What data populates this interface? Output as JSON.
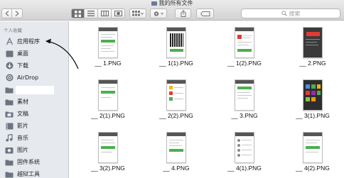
{
  "window": {
    "title": "我的所有文件"
  },
  "toolbar": {
    "search_placeholder": "搜索"
  },
  "sidebar": {
    "section_header": "个人收藏",
    "items": [
      {
        "label": "应用程序",
        "icon": "applications-icon"
      },
      {
        "label": "桌面",
        "icon": "desktop-icon"
      },
      {
        "label": "下载",
        "icon": "downloads-icon"
      },
      {
        "label": "AirDrop",
        "icon": "airdrop-icon"
      },
      {
        "label": "",
        "icon": "folder-icon"
      },
      {
        "label": "素材",
        "icon": "folder-icon"
      },
      {
        "label": "文稿",
        "icon": "documents-icon"
      },
      {
        "label": "影片",
        "icon": "movies-icon"
      },
      {
        "label": "音乐",
        "icon": "music-icon"
      },
      {
        "label": "图片",
        "icon": "pictures-icon"
      },
      {
        "label": "固件系统",
        "icon": "folder-icon"
      },
      {
        "label": "越狱工具",
        "icon": "folder-icon"
      }
    ]
  },
  "files": [
    {
      "name": "__ 1.PNG"
    },
    {
      "name": "__ 1(1).PNG"
    },
    {
      "name": "__ 1(2).PNG"
    },
    {
      "name": "__ 2.PNG"
    },
    {
      "name": "__ 2(1).PNG"
    },
    {
      "name": "__ 2(2).PNG"
    },
    {
      "name": "__ 3.PNG"
    },
    {
      "name": "__ 3(1).PNG"
    },
    {
      "name": "__ 3(2).PNG"
    },
    {
      "name": "__ 4.PNG"
    },
    {
      "name": "__ 4(1).PNG"
    },
    {
      "name": "__ 4(2).PNG"
    }
  ]
}
